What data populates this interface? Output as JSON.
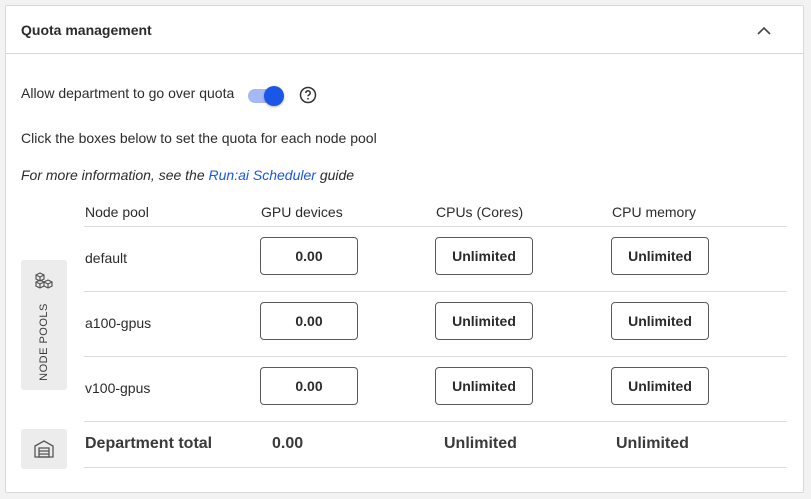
{
  "header": {
    "title": "Quota management",
    "collapse_icon": "chevron-up-icon"
  },
  "over_quota": {
    "label": "Allow department to go over quota",
    "enabled": true,
    "help_icon": "question-circle-icon"
  },
  "instruction": "Click the boxes below to set the quota for each node pool",
  "info": {
    "prefix": "For more information, see the ",
    "link_text": "Run:ai Scheduler",
    "suffix": " guide"
  },
  "side_tab": {
    "label": "NODE POOLS",
    "icon": "cubes-icon"
  },
  "columns": [
    "Node pool",
    "GPU devices",
    "CPUs (Cores)",
    "CPU memory"
  ],
  "pools": [
    {
      "name": "default",
      "gpu": "0.00",
      "cpu": "Unlimited",
      "memory": "Unlimited"
    },
    {
      "name": "a100-gpus",
      "gpu": "0.00",
      "cpu": "Unlimited",
      "memory": "Unlimited"
    },
    {
      "name": "v100-gpus",
      "gpu": "0.00",
      "cpu": "Unlimited",
      "memory": "Unlimited"
    }
  ],
  "total": {
    "icon": "warehouse-icon",
    "label": "Department total",
    "gpu": "0.00",
    "cpu": "Unlimited",
    "memory": "Unlimited"
  },
  "colors": {
    "accent": "#1a56e8",
    "toggle_track": "#a6b9f5",
    "side_bg": "#ececec"
  }
}
